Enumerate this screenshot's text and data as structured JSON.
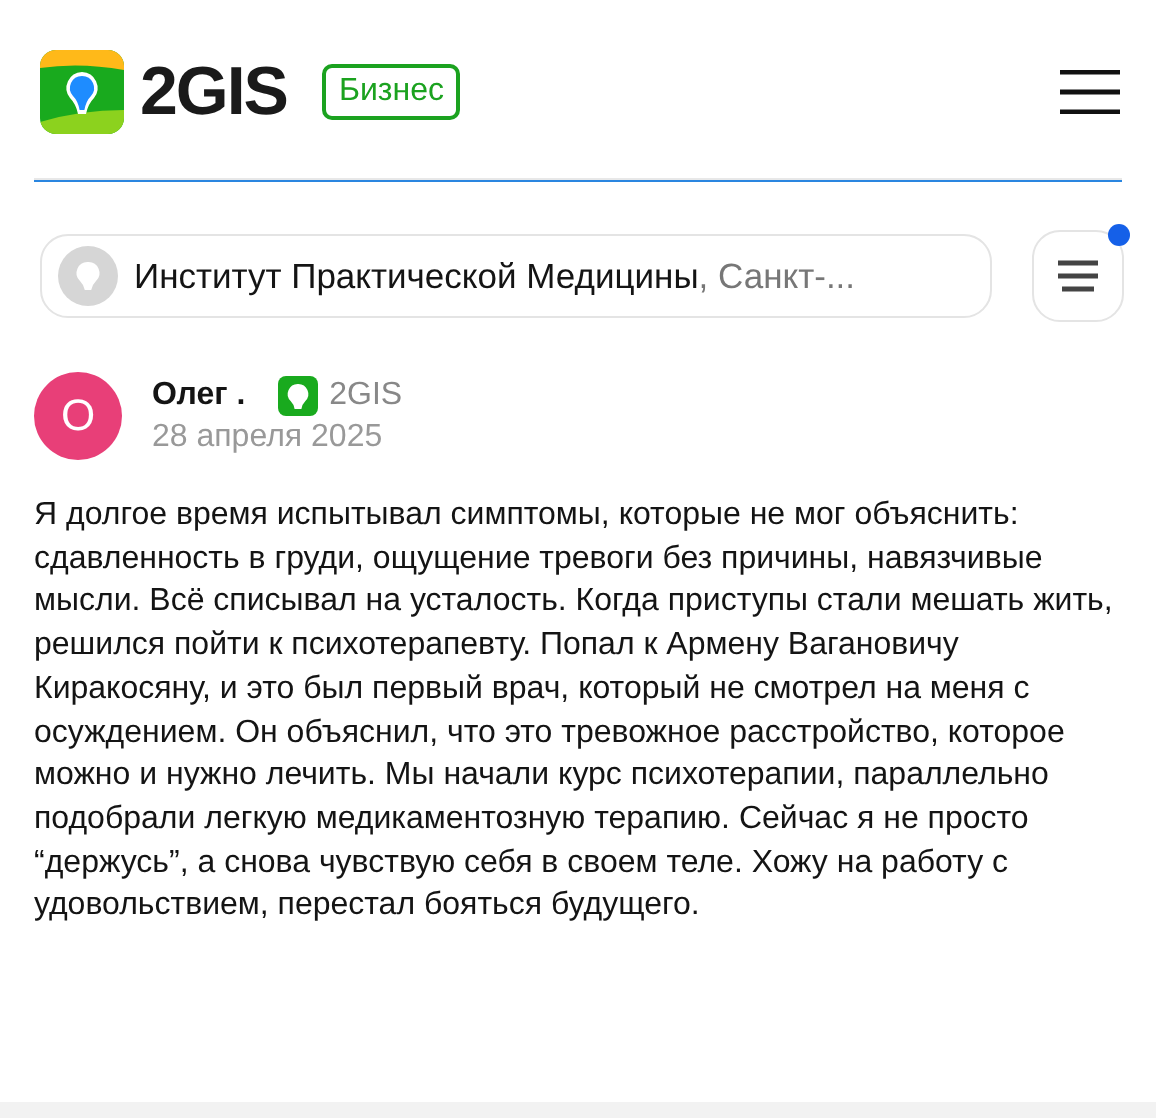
{
  "header": {
    "logo_text": "2GIS",
    "badge": "Бизнес"
  },
  "place": {
    "name": "Институт Практической Медицины",
    "city": ", Санкт-...",
    "notification": true
  },
  "review": {
    "avatar_letter": "О",
    "author": "Олег .",
    "source": "2GIS",
    "date": "28 апреля 2025",
    "text": "Я долгое время испытывал симптомы, которые не мог объяснить: сдавленность в груди, ощущение тревоги без причины, навязчивые мысли. Всё списывал на усталость. Когда приступы стали мешать жить, решился пойти к психотерапевту. Попал к Армену Вагановичу Киракосяну, и это был первый врач, который не смотрел на меня с осуждением. Он объяснил, что это тревожное расстройство, которое можно и нужно лечить. Мы начали курс психотерапии, параллельно подобрали легкую медикаментозную терапию. Сейчас я не просто “держусь”, а снова чувствую себя в своем теле. Хожу на работу с удовольствием, перестал бояться будущего."
  }
}
